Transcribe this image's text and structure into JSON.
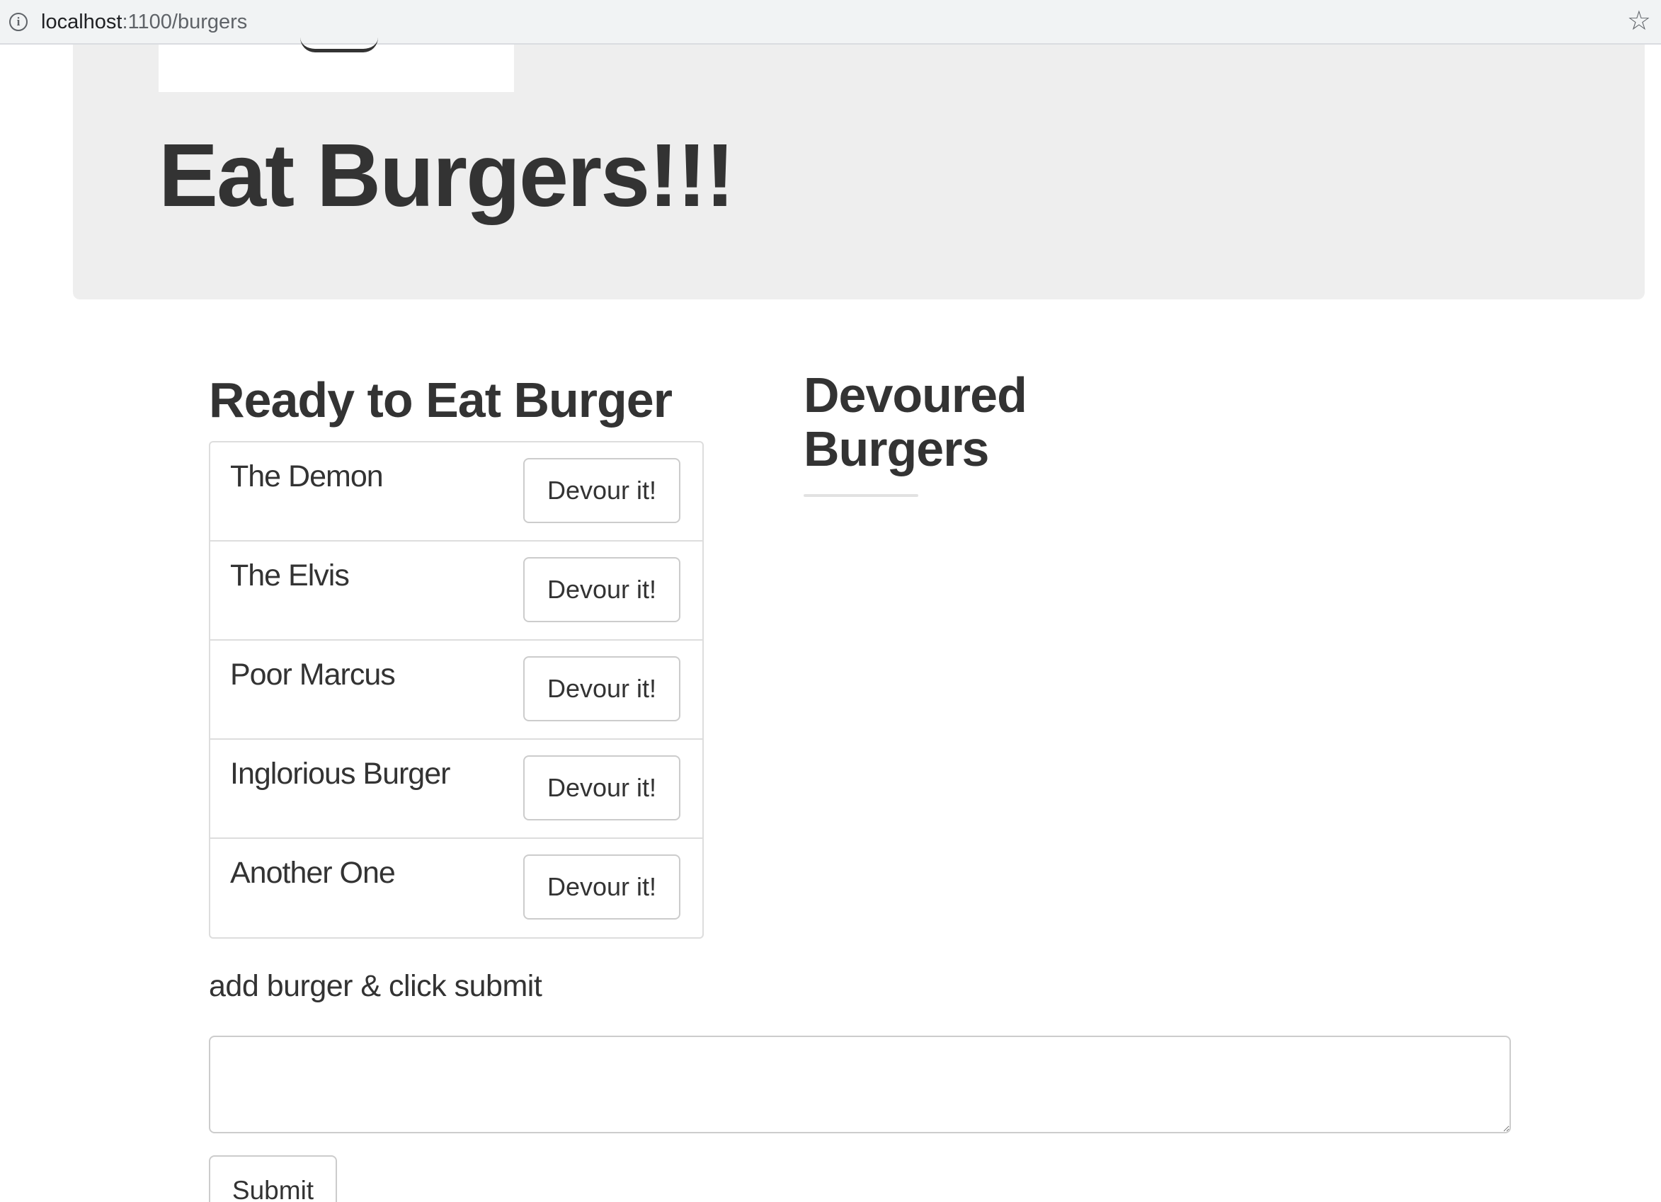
{
  "browser": {
    "url_host": "localhost",
    "url_path": ":1100/burgers"
  },
  "jumbotron": {
    "title": "Eat Burgers!!!"
  },
  "ready": {
    "heading": "Ready to Eat Burger",
    "items": [
      {
        "name": "The Demon",
        "button": "Devour it!"
      },
      {
        "name": "The Elvis",
        "button": "Devour it!"
      },
      {
        "name": "Poor Marcus",
        "button": "Devour it!"
      },
      {
        "name": "Inglorious Burger",
        "button": "Devour it!"
      },
      {
        "name": "Another One",
        "button": "Devour it!"
      }
    ]
  },
  "devoured": {
    "heading_line1": "Devoured",
    "heading_line2": "Burgers"
  },
  "form": {
    "label": "add burger & click submit",
    "textarea_value": "",
    "submit_label": "Submit"
  }
}
